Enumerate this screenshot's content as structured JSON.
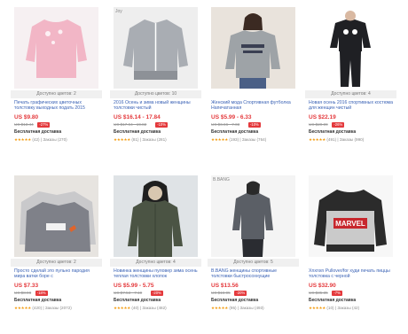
{
  "products": [
    {
      "available": "Доступно цветов: 2",
      "title": "Печать графических цветочных толстовку выходных подать 2015",
      "price": "US $9.80",
      "old_price": "US $13.44",
      "discount": "-27%",
      "shipping": "Бесплатная доставка",
      "stars": "★★★★★",
      "reviews": "(42)",
      "orders": "Заказы (270)",
      "watermark": "",
      "image_colors": {
        "bg": "#f6f0f2",
        "garment": "#f2b6c6",
        "detail": "#ffffff"
      }
    },
    {
      "available": "Доступно цветов: 10",
      "title": "2016 Осень и зима новый женщины толстовки чистый",
      "price": "US $16.14 - 17.84",
      "old_price": "US $17.94 - 19.82",
      "discount": "-10%",
      "shipping": "Бесплатная доставка",
      "stars": "★★★★★",
      "reviews": "(81)",
      "orders": "Заказы (281)",
      "watermark": "Joy",
      "image_colors": {
        "bg": "#eeeeee",
        "garment": "#a9adb3",
        "detail": "#ffffff"
      }
    },
    {
      "available": "",
      "title": "Женский мода Спортивная футболка Напечатанная",
      "price": "US $5.99 - 6.33",
      "old_price": "US $6.66 - 7.03",
      "discount": "-10%",
      "shipping": "Бесплатная доставка",
      "stars": "★★★★★",
      "reviews": "(193)",
      "orders": "Заказы (764)",
      "watermark": "",
      "image_colors": {
        "bg": "#e9e3dc",
        "garment": "#9ea3a7",
        "detail": "#3a3f52"
      }
    },
    {
      "available": "Доступно цветов: 4",
      "title": "Новая осень 2016 спортивных костюма для женщин чистый",
      "price": "US $22.19",
      "old_price": "US $29.99",
      "discount": "-26%",
      "shipping": "Бесплатная доставка",
      "stars": "★★★★★",
      "reviews": "(491)",
      "orders": "Заказы (990)",
      "watermark": "",
      "image_colors": {
        "bg": "#ffffff",
        "garment": "#1f2024",
        "detail": "#ffffff"
      }
    },
    {
      "available": "Доступно цветов: 2",
      "title": "Просто сделай это пульно пародия мира ватки боре с",
      "price": "US $7.33",
      "old_price": "US $8.98",
      "discount": "-18%",
      "shipping": "Бесплатная доставка",
      "stars": "★★★★★",
      "reviews": "(420)",
      "orders": "Заказы (2072)",
      "watermark": "",
      "image_colors": {
        "bg": "#e7e4e0",
        "garment": "#7f8189",
        "detail": "#f2f2f2"
      }
    },
    {
      "available": "Доступно цветов: 4",
      "title": "Новинка женщины пуловер зима осень теплая толстовки хлопок",
      "price": "US $5.99 - 5.75",
      "old_price": "US $7.53 - 7.19",
      "discount": "-20%",
      "shipping": "Бесплатная доставка",
      "stars": "★★★★★",
      "reviews": "(40)",
      "orders": "Заказы (482)",
      "watermark": "",
      "image_colors": {
        "bg": "#dfe3e6",
        "garment": "#4b5444",
        "detail": "#d8c7b0"
      }
    },
    {
      "available": "Доступно цветов: 5",
      "title": "B.BANG женщины спортивные толстовки быстросохнущие",
      "price": "US $13.56",
      "old_price": "US $16.95",
      "discount": "-20%",
      "shipping": "Бесплатная доставка",
      "stars": "★★★★★",
      "reviews": "(95)",
      "orders": "Заказы (493)",
      "watermark": "B.BANG",
      "image_colors": {
        "bg": "#f4f4f4",
        "garment": "#5b5f66",
        "detail": "#2a2c31"
      }
    },
    {
      "available": "",
      "title": "Xnxnxn Pullover/for худи печать пиццы толстовка с черной",
      "price": "US $32.90",
      "old_price": "US $35.35",
      "discount": "-7%",
      "shipping": "Бесплатная доставка",
      "stars": "★★★★★",
      "reviews": "(10)",
      "orders": "Заказы (42)",
      "watermark": "",
      "image_colors": {
        "bg": "#f7f7f7",
        "garment": "#2b2b2b",
        "detail": "#c7272d"
      }
    }
  ]
}
